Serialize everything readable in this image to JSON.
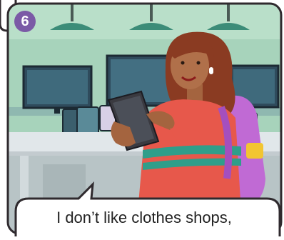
{
  "panel": {
    "number": "6",
    "speech": "I don’t like clothes shops,"
  },
  "colors": {
    "border": "#2f2a2e",
    "wall": "#9cc9b0",
    "floor": "#cfd6d6",
    "table": "#dfe5e8",
    "shirt": "#e7584b",
    "stripe": "#2f9e8a",
    "backpack": "#c06ad4",
    "lamp": "#3c8c78",
    "badge": "#7b5aa6"
  }
}
